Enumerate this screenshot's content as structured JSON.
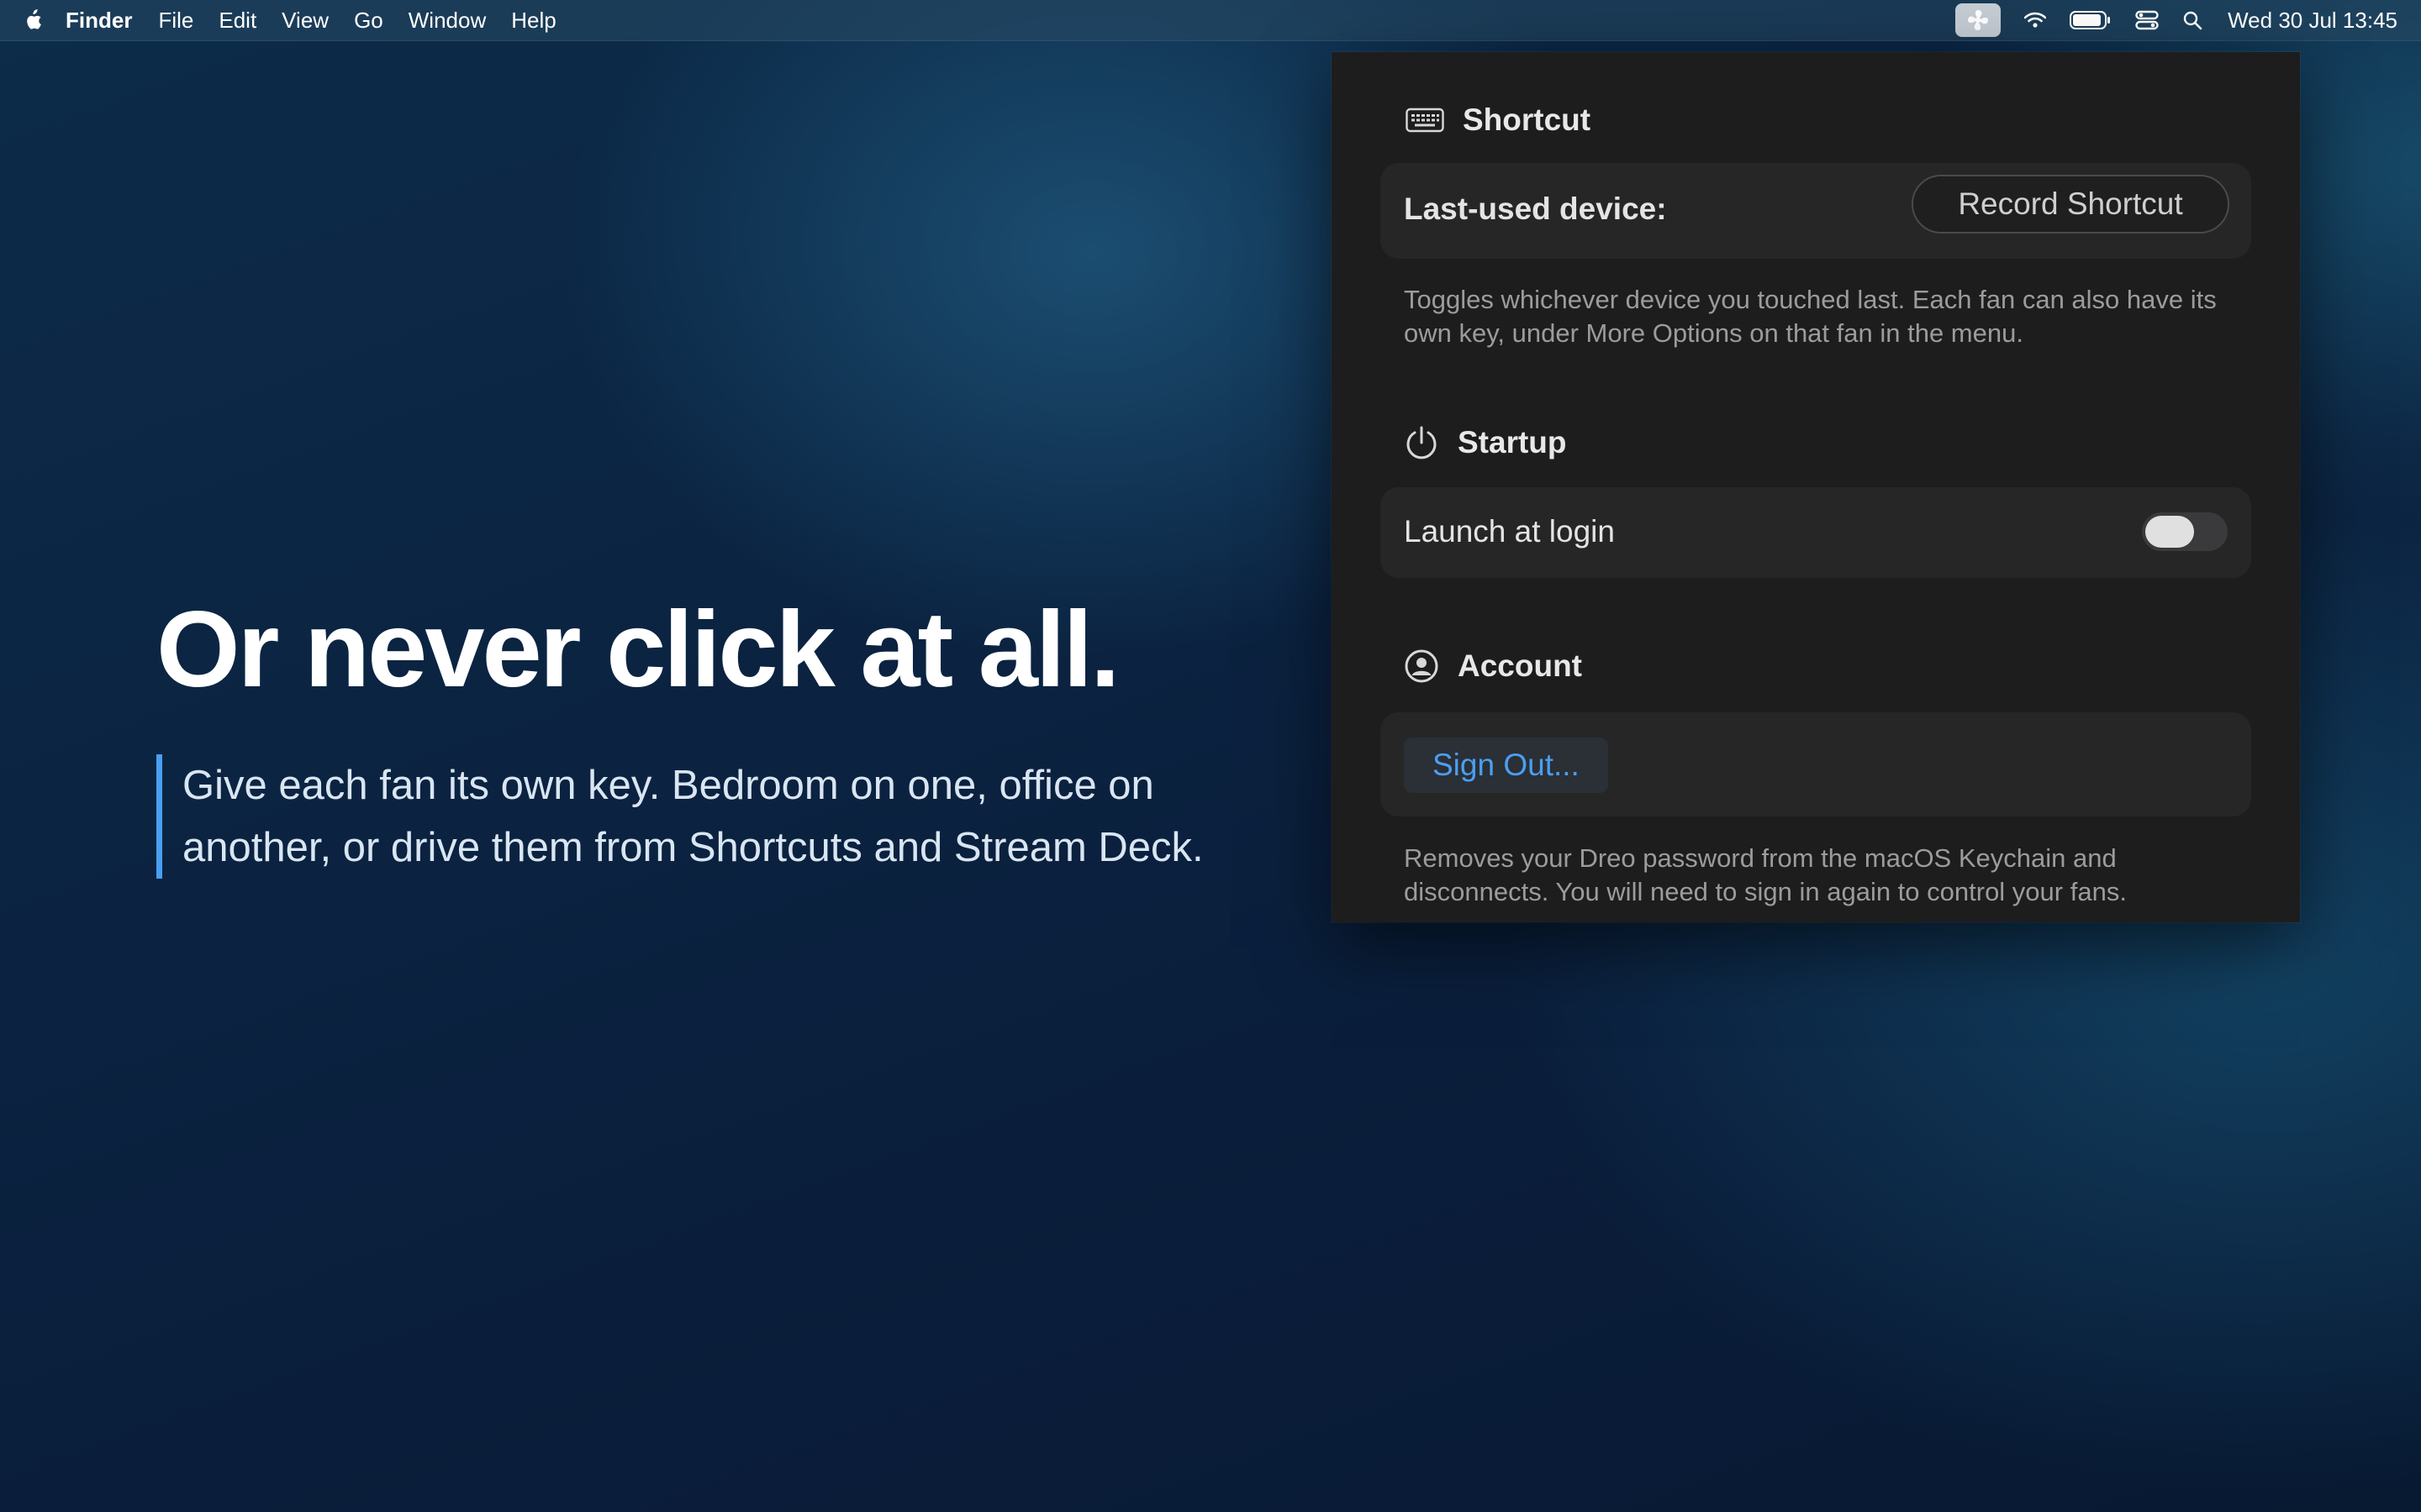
{
  "menubar": {
    "app_name": "Finder",
    "menus": [
      "File",
      "Edit",
      "View",
      "Go",
      "Window",
      "Help"
    ],
    "clock": "Wed 30 Jul 13:45"
  },
  "hero": {
    "title": "Or never click at all.",
    "quote": "Give each fan its own key. Bedroom on one, office on another, or drive them from Shortcuts and Stream Deck."
  },
  "settings": {
    "shortcut": {
      "header": "Shortcut",
      "row_label": "Last-used device:",
      "button_label": "Record Shortcut",
      "caption": "Toggles whichever device you touched last. Each fan can also have its own key, under More Options on that fan in the menu."
    },
    "startup": {
      "header": "Startup",
      "row_label": "Launch at login",
      "launch_at_login": false
    },
    "account": {
      "header": "Account",
      "button_label": "Sign Out...",
      "caption": "Removes your Dreo password from the macOS Keychain and disconnects. You will need to sign in again to control your fans."
    }
  },
  "colors": {
    "accent": "#4a9ff0",
    "panel_bg": "#1d1d1e",
    "card_bg": "#262627"
  }
}
